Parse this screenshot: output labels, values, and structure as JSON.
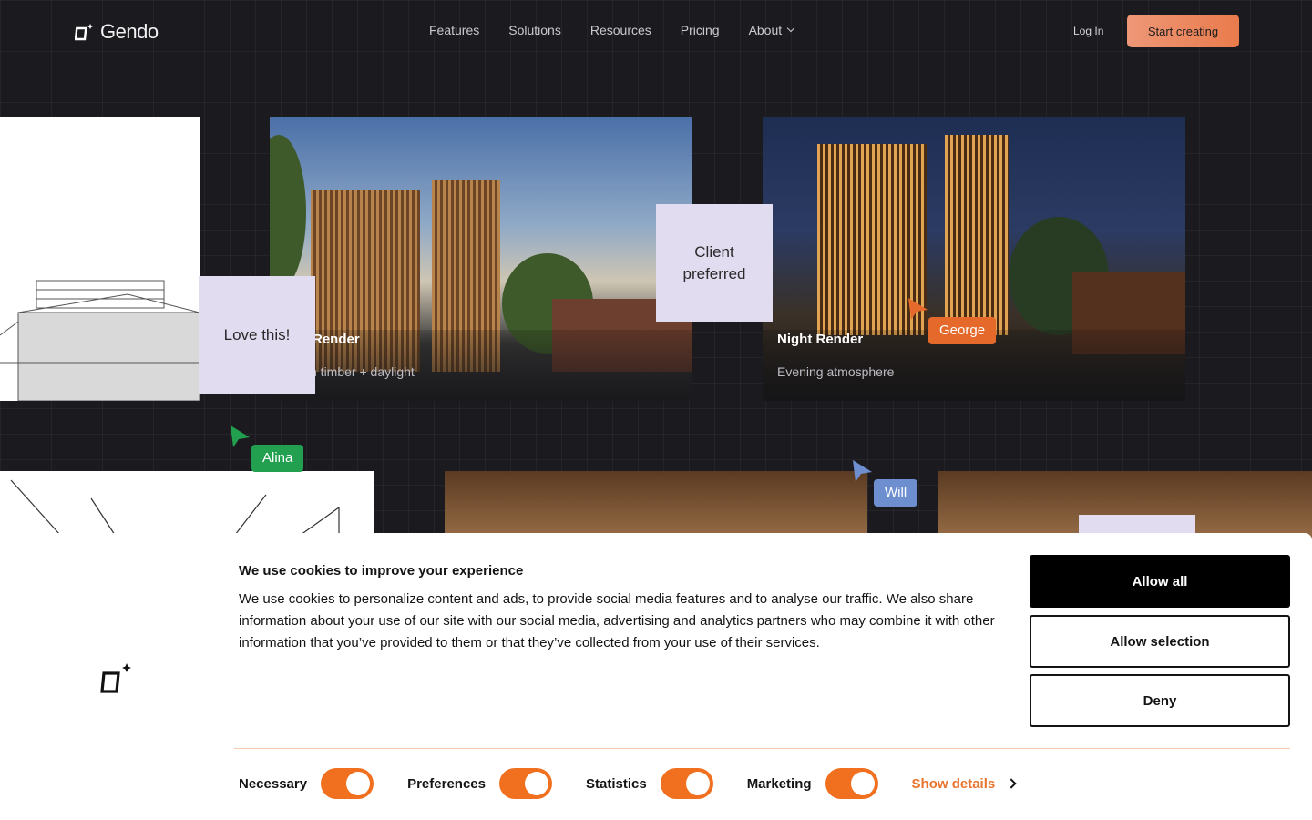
{
  "nav": {
    "brand": "Gendo",
    "links": [
      "Features",
      "Solutions",
      "Resources",
      "Pricing",
      "About"
    ],
    "login": "Log In",
    "cta": "Start creating"
  },
  "canvas": {
    "day_card": {
      "title": "Render",
      "subtitle": "n timber + daylight"
    },
    "night_card": {
      "title": "Night Render",
      "subtitle": "Evening atmosphere"
    },
    "notes": {
      "love": "Love this!",
      "client": "Client preferred"
    },
    "cursors": {
      "alina": "Alina",
      "george": "George",
      "will": "Will"
    },
    "colors": {
      "alina": "#22a04f",
      "george": "#e5692a",
      "will": "#6d8ecf",
      "accent": "#e97b4c",
      "note": "#e1dcf0"
    }
  },
  "cookie": {
    "title": "We use cookies to improve your experience",
    "text": "We use cookies to personalize content and ads, to provide social media features and to analyse our traffic. We also share information about your use of our site with our social media, advertising and analytics partners who may combine it with other information that you’ve provided to them or that they’ve collected from your use of their services.",
    "buttons": {
      "allow_all": "Allow all",
      "allow_selection": "Allow selection",
      "deny": "Deny"
    },
    "toggles": [
      {
        "label": "Necessary",
        "on": true
      },
      {
        "label": "Preferences",
        "on": true
      },
      {
        "label": "Statistics",
        "on": true
      },
      {
        "label": "Marketing",
        "on": true
      }
    ],
    "show_details": "Show details"
  }
}
